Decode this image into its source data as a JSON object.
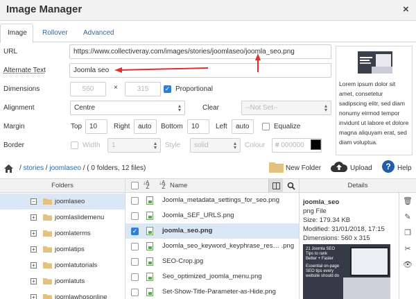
{
  "window": {
    "title": "Image Manager",
    "close_glyph": "×"
  },
  "tabs": [
    {
      "label": "Image",
      "active": true
    },
    {
      "label": "Rollover",
      "active": false
    },
    {
      "label": "Advanced",
      "active": false
    }
  ],
  "form": {
    "url_label": "URL",
    "url_value": "https://www.collectiveray.com/images/stories/joomlaseo/joomla_seo.png",
    "alt_label": "Alternate Text",
    "alt_value": "Joomla seo",
    "dimensions_label": "Dimensions",
    "width": "560",
    "times": "×",
    "height": "315",
    "proportional_label": "Proportional",
    "proportional_checked": true,
    "alignment_label": "Alignment",
    "alignment_value": "Centre",
    "clear_label": "Clear",
    "clear_value": "--Not Set--",
    "margin_label": "Margin",
    "top_label": "Top",
    "top_value": "10",
    "right_label": "Right",
    "right_value": "auto",
    "bottom_label": "Bottom",
    "bottom_value": "10",
    "left_label": "Left",
    "left_value": "auto",
    "equalize_label": "Equalize",
    "border_label": "Border",
    "border_width_label": "Width",
    "border_width_value": "1",
    "border_style_label": "Style",
    "border_style_value": "solid",
    "border_colour_label": "Colour",
    "border_colour_value": "000000",
    "border_colour_swatch": "#000000"
  },
  "preview": {
    "text": "Lorem ipsum dolor sit amet, consetetur sadipscing elitr, sed diam nonumy eirmod tempor invidunt ut labore et dolore magna aliquyam erat, sed diam voluptua."
  },
  "pathbar": {
    "separator": "/",
    "crumbs": [
      "stories",
      "joomlaseo"
    ],
    "summary": "( 0 folders, 12 files)",
    "new_folder_label": "New Folder",
    "upload_label": "Upload",
    "help_label": "Help"
  },
  "folders_panel": {
    "header": "Folders",
    "items": [
      {
        "name": "joomlaseo",
        "selected": true,
        "toggle": "−"
      },
      {
        "name": "joomlaslidemenu",
        "selected": false,
        "toggle": "+"
      },
      {
        "name": "joomlaterms",
        "selected": false,
        "toggle": "+"
      },
      {
        "name": "joomlatips",
        "selected": false,
        "toggle": "+"
      },
      {
        "name": "joomlatutorials",
        "selected": false,
        "toggle": "+"
      },
      {
        "name": "joomlatuts",
        "selected": false,
        "toggle": "+"
      },
      {
        "name": "joomlawhosonline",
        "selected": false,
        "toggle": "+"
      }
    ]
  },
  "files_panel": {
    "name_header": "Name",
    "sort_glyph": "↓A Z",
    "files": [
      {
        "name": "Joomla_metadata_settings_for_seo.png",
        "selected": false
      },
      {
        "name": "Joomla_SEF_URLS.png",
        "selected": false
      },
      {
        "name": "joomla_seo.png",
        "selected": true
      },
      {
        "name": "Joomla_seo_keyword_keyphrase_res… .png",
        "selected": false
      },
      {
        "name": "SEO-Crop.jpg",
        "selected": false
      },
      {
        "name": "Seo_optimized_joomla_menu.png",
        "selected": false
      },
      {
        "name": "Set-Show-Title-Parameter-as-Hide.png",
        "selected": false
      }
    ]
  },
  "details_panel": {
    "header": "Details",
    "file_name": "joomla_seo",
    "file_type": "png File",
    "size": "Size: 179.34 KB",
    "modified": "Modified: 31/01/2018, 17:15",
    "dimensions": "Dimensions: 560 x 315",
    "thumb_lines": [
      "21 Joomla SEO",
      "Tips to rank",
      "Better + Faster",
      "Essential on-page",
      "SEO tips every",
      "website should do"
    ]
  },
  "colors": {
    "accent": "#2f7fd6",
    "link": "#2a6aa8",
    "arrow": "#e03030",
    "selected_row": "#dbe7f5"
  }
}
